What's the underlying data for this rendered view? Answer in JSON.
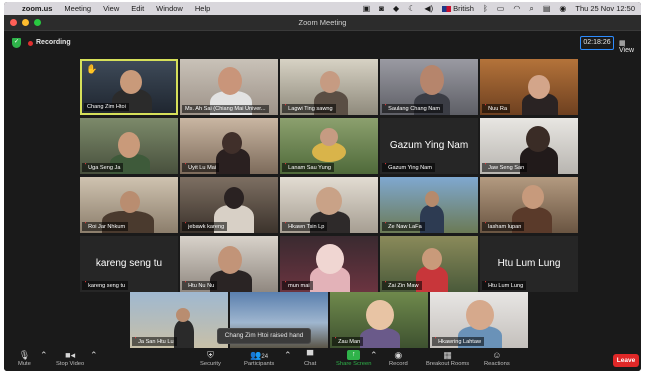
{
  "menubar": {
    "app": "zoom.us",
    "menus": [
      "Meeting",
      "View",
      "Edit",
      "Window",
      "Help"
    ],
    "input_source": "British",
    "datetime": "Thu 25 Nov  12:50"
  },
  "window": {
    "title": "Zoom Meeting"
  },
  "topbar": {
    "recording": "Recording",
    "timer": "02:18:26",
    "view": "View"
  },
  "participants": [
    {
      "name": "Chang Zim Htoi",
      "muted": false,
      "video": true,
      "hand": true,
      "active": true
    },
    {
      "name": "Ms. Ah Sai (Chiang Mai Univer...",
      "muted": false,
      "video": true
    },
    {
      "name": "Lagwi Ting sawng",
      "muted": true,
      "video": true
    },
    {
      "name": "Saulang Chang Nam",
      "muted": true,
      "video": true
    },
    {
      "name": "Nuu Ra",
      "muted": true,
      "video": true
    },
    {
      "name": "Uga Seng Ja",
      "muted": true,
      "video": true
    },
    {
      "name": "Uyit Lu Mai",
      "muted": true,
      "video": true
    },
    {
      "name": "Lanam Sau Yung",
      "muted": true,
      "video": true
    },
    {
      "name": "Gazum Ying Nam",
      "muted": true,
      "video": false
    },
    {
      "name": "Jaw Seng San",
      "muted": true,
      "video": true
    },
    {
      "name": "Roi Jar Nhkum",
      "muted": true,
      "video": true
    },
    {
      "name": "jebawk kareng",
      "muted": true,
      "video": true
    },
    {
      "name": "Hkawn Tsin Lp",
      "muted": true,
      "video": true
    },
    {
      "name": "Ze Naw LaFa",
      "muted": true,
      "video": true
    },
    {
      "name": "lasham lupan",
      "muted": true,
      "video": true
    },
    {
      "name": "kareng seng tu",
      "muted": true,
      "video": false
    },
    {
      "name": "Htu Nu Nu",
      "muted": true,
      "video": true
    },
    {
      "name": "mun mai",
      "muted": true,
      "video": true
    },
    {
      "name": "Zai Zin Maw",
      "muted": true,
      "video": true
    },
    {
      "name": "Htu Lum Lung",
      "muted": true,
      "video": false
    },
    {
      "name": "Ja San Htu Lu",
      "muted": true,
      "video": true
    },
    {
      "name": "",
      "muted": false,
      "video": true
    },
    {
      "name": "Zau Man",
      "muted": true,
      "video": true
    },
    {
      "name": "Hkawring Lahtaw",
      "muted": true,
      "video": true
    }
  ],
  "toast": "Chang Zim Htoi raised hand",
  "toolbar": {
    "mute": "Mute",
    "stop_video": "Stop Video",
    "security": "Security",
    "participants": "Participants",
    "participants_count": "24",
    "chat": "Chat",
    "share_screen": "Share Screen",
    "record": "Record",
    "breakout_rooms": "Breakout Rooms",
    "reactions": "Reactions",
    "leave": "Leave"
  },
  "colors": {
    "active_speaker": "#d6e05a",
    "mute": "#ff3b3b",
    "share": "#2fb34a",
    "leave": "#e02828"
  }
}
